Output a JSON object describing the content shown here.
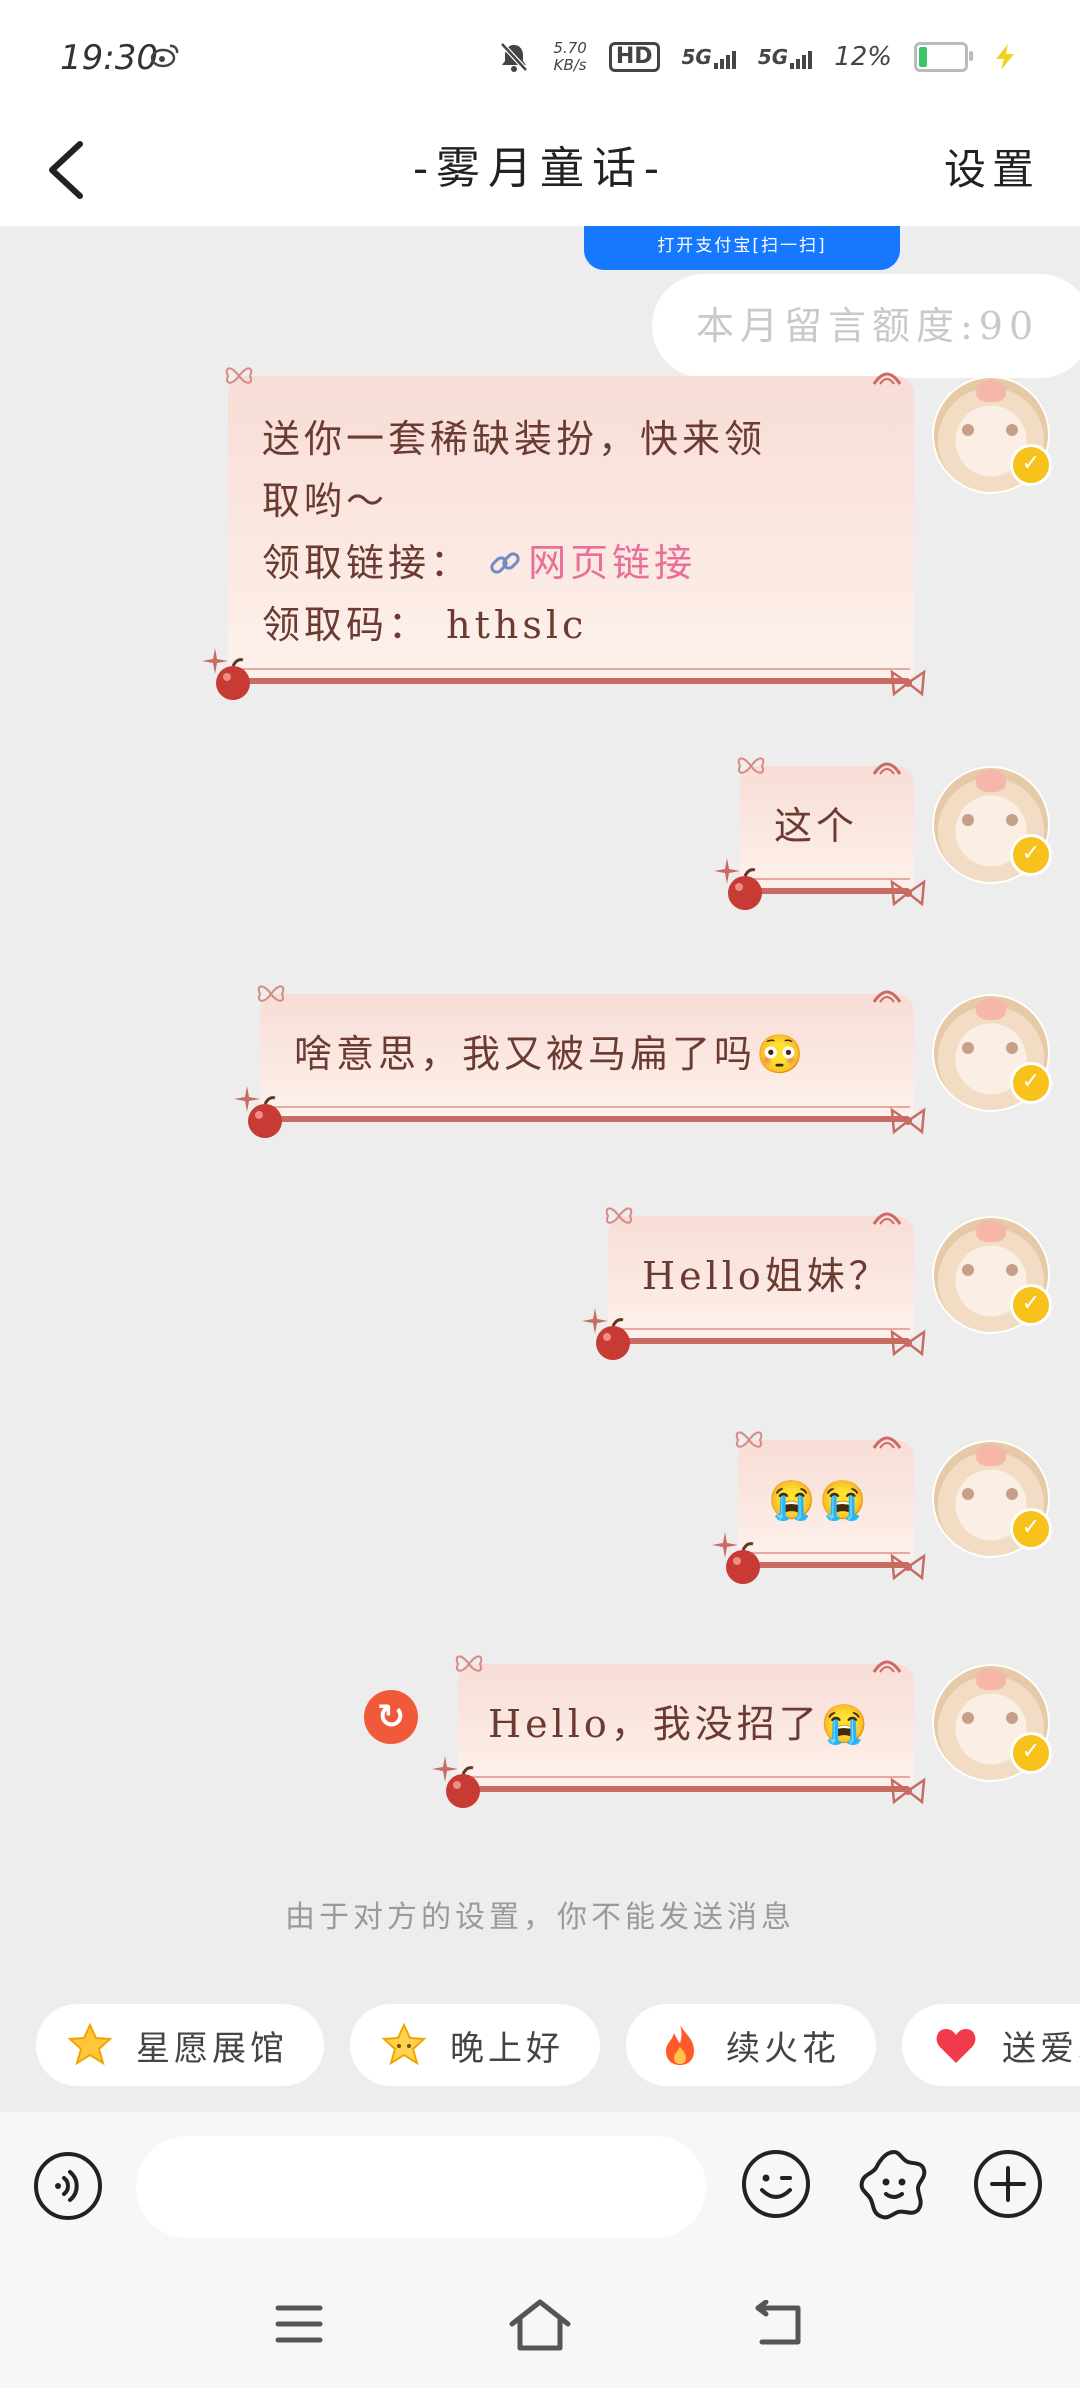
{
  "status_bar": {
    "time": "19:30",
    "net_speed_value": "5.70",
    "net_speed_unit": "KB/s",
    "hd_label": "HD",
    "sim1_label": "5G",
    "sim2_label": "5G",
    "battery_percent": "12%"
  },
  "header": {
    "title": "-雾月童话-",
    "settings_label": "设置"
  },
  "banner": {
    "pay_text": "打开支付宝[扫一扫]",
    "quota_text": "本月留言额度:90"
  },
  "messages": [
    {
      "line1": "送你一套稀缺装扮，快来领",
      "line2": "取哟～",
      "link_label": "领取链接：",
      "link_text": "网页链接",
      "code_label": "领取码：",
      "code_value": "hthslc"
    },
    {
      "text": "这个"
    },
    {
      "text": "啥意思，我又被马扁了吗😳"
    },
    {
      "text": "Hello姐妹？"
    },
    {
      "text": "😭😭"
    },
    {
      "text": "Hello，我没招了😭",
      "failed": true
    }
  ],
  "notice": "由于对方的设置，你不能发送消息",
  "quick_chips": [
    {
      "label": "星愿展馆",
      "icon": "star-icon"
    },
    {
      "label": "晚上好",
      "icon": "star-icon"
    },
    {
      "label": "续火花",
      "icon": "fire-icon"
    },
    {
      "label": "送爱心",
      "icon": "heart-icon"
    }
  ],
  "colors": {
    "pay_blue": "#1677ff",
    "resend_red": "#f05a3a",
    "verified_yellow": "#f7c21b",
    "link_pink": "#e86f9a",
    "chat_bg": "#ededed"
  }
}
